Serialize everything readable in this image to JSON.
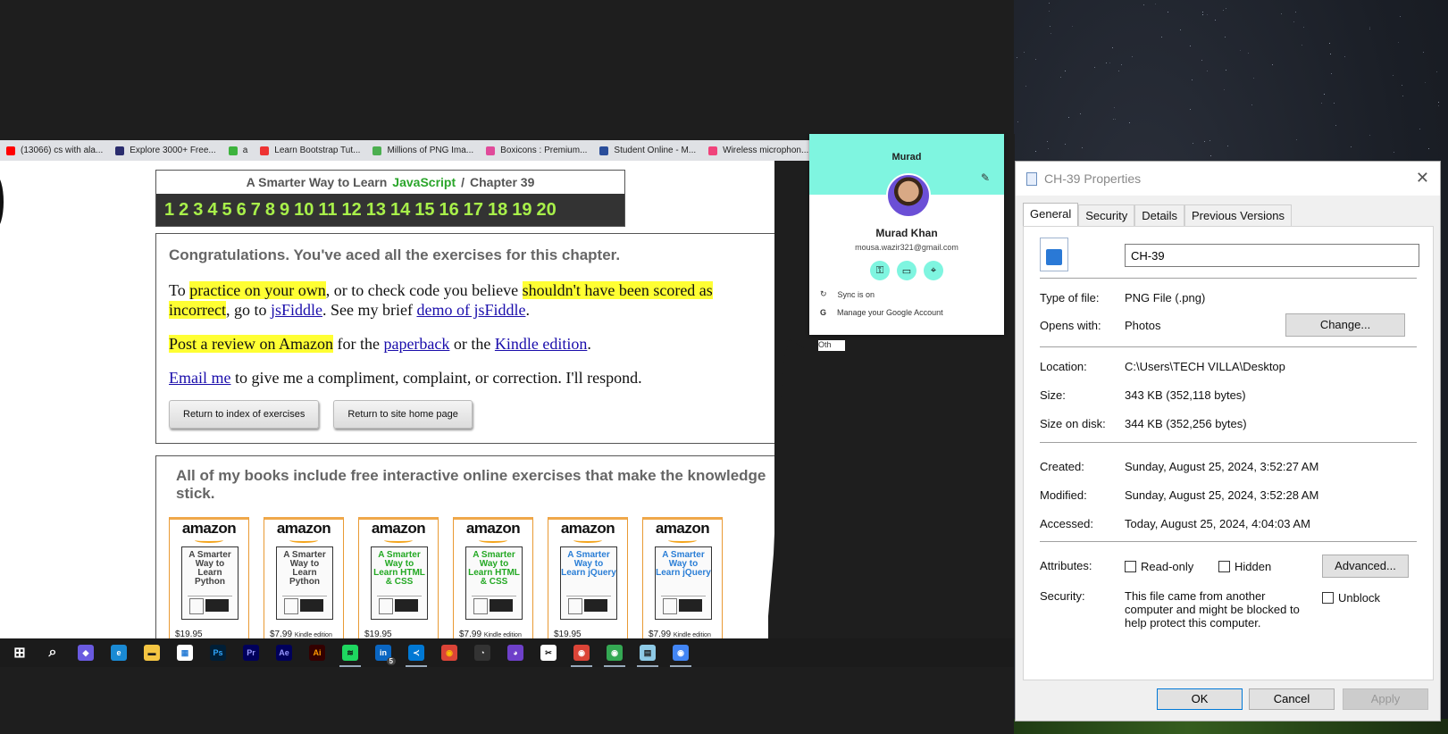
{
  "bookmarks": [
    {
      "label": "(13066) cs with ala...",
      "icon": "youtube-icon",
      "color": "#ff0000"
    },
    {
      "label": "Explore 3000+ Free...",
      "icon": "ui-icon",
      "color": "#2b2d6e"
    },
    {
      "label": "a",
      "icon": "s-icon",
      "color": "#3db33d"
    },
    {
      "label": "Learn Bootstrap Tut...",
      "icon": "v-icon",
      "color": "#e33"
    },
    {
      "label": "Millions of PNG Ima...",
      "icon": "pngtree-icon",
      "color": "#4caf50"
    },
    {
      "label": "Boxicons : Premium...",
      "icon": "boxicons-icon",
      "color": "#e04a9a"
    },
    {
      "label": "Student Online - M...",
      "icon": "student-icon",
      "color": "#2a4d9a"
    },
    {
      "label": "Wireless microphon...",
      "icon": "daraz-icon",
      "color": "#f0437b"
    }
  ],
  "chapter": {
    "prefix": "A Smarter Way to Learn",
    "subject": "JavaScript",
    "separator": "/",
    "label": "Chapter 39",
    "numbers": [
      "1",
      "2",
      "3",
      "4",
      "5",
      "6",
      "7",
      "8",
      "9",
      "10",
      "11",
      "12",
      "13",
      "14",
      "15",
      "16",
      "17",
      "18",
      "19",
      "20"
    ]
  },
  "congrats": {
    "title": "Congratulations. You've aced all the exercises for this chapter.",
    "p1": {
      "a": "To ",
      "hl1": "practice on your own",
      "b": ", or to check code you believe ",
      "hl2": "shouldn't have been scored as incorrect",
      "c": ", go to ",
      "link1": "jsFiddle",
      "d": ". See my brief ",
      "link2": "demo of jsFiddle",
      "e": "."
    },
    "p2": {
      "hl": "Post a review on Amazon",
      "a": " for the ",
      "link1": "paperback",
      "b": " or the ",
      "link2": "Kindle edition",
      "c": "."
    },
    "p3": {
      "link": "Email me",
      "a": " to give me a compliment, complaint, or correction. I'll respond."
    },
    "btn_index": "Return to index of exercises",
    "btn_home": "Return to site home page"
  },
  "books": {
    "title": "All of my books include free interactive online exercises that make the knowledge stick.",
    "brand": "amazon",
    "items": [
      {
        "cover": "A Smarter Way to Learn Python",
        "price": "$19.95",
        "edition": "",
        "color": "#444"
      },
      {
        "cover": "A Smarter Way to Learn Python",
        "price": "$7.99",
        "edition": "Kindle edition",
        "color": "#444"
      },
      {
        "cover": "A Smarter Way to Learn HTML & CSS",
        "price": "$19.95",
        "edition": "",
        "color": "#23a823"
      },
      {
        "cover": "A Smarter Way to Learn HTML & CSS",
        "price": "$7.99",
        "edition": "Kindle edition",
        "color": "#23a823"
      },
      {
        "cover": "A Smarter Way to Learn jQuery",
        "price": "$19.95",
        "edition": "",
        "color": "#2a7ed6"
      },
      {
        "cover": "A Smarter Way to Learn jQuery",
        "price": "$7.99",
        "edition": "Kindle edition",
        "color": "#2a7ed6"
      }
    ]
  },
  "profile": {
    "header_name": "Murad",
    "name": "Murad Khan",
    "email": "mousa.wazir321@gmail.com",
    "sync": "Sync is on",
    "manage": "Manage your Google Account",
    "other": "Oth",
    "accent": "#7ff5e0"
  },
  "taskbar": [
    {
      "name": "start-button",
      "icon": "windows-icon",
      "text": "⊞",
      "color": "#ffffff",
      "bg": "transparent"
    },
    {
      "name": "search-button",
      "icon": "search-icon",
      "text": "⌕",
      "color": "#ffffff",
      "bg": "transparent"
    },
    {
      "name": "copilot-button",
      "icon": "copilot-icon",
      "text": "◆",
      "color": "#ffffff",
      "bg": "#6a5ae0"
    },
    {
      "name": "edge-button",
      "icon": "edge-icon",
      "text": "e",
      "color": "#ffffff",
      "bg": "#1a8ad4"
    },
    {
      "name": "explorer-button",
      "icon": "folder-icon",
      "text": "▬",
      "color": "#1b1b1b",
      "bg": "#f4c542"
    },
    {
      "name": "store-button",
      "icon": "store-icon",
      "text": "▦",
      "color": "#2a7ed6",
      "bg": "#ffffff"
    },
    {
      "name": "photoshop-button",
      "icon": "photoshop-icon",
      "text": "Ps",
      "color": "#31a8ff",
      "bg": "#001e36"
    },
    {
      "name": "premiere-button",
      "icon": "premiere-icon",
      "text": "Pr",
      "color": "#9999ff",
      "bg": "#00005b"
    },
    {
      "name": "aftereffects-button",
      "icon": "aftereffects-icon",
      "text": "Ae",
      "color": "#9999ff",
      "bg": "#00005b"
    },
    {
      "name": "illustrator-button",
      "icon": "illustrator-icon",
      "text": "Ai",
      "color": "#ff9a00",
      "bg": "#330000"
    },
    {
      "name": "spotify-button",
      "icon": "spotify-icon",
      "text": "≋",
      "color": "#111111",
      "bg": "#1ed760"
    },
    {
      "name": "linkedin-button",
      "icon": "linkedin-icon",
      "text": "in",
      "color": "#ffffff",
      "bg": "#0a66c2"
    },
    {
      "name": "vscode-button",
      "icon": "vscode-icon",
      "text": "≺",
      "color": "#ffffff",
      "bg": "#0078d4"
    },
    {
      "name": "chrome-button",
      "icon": "chrome-icon",
      "text": "◉",
      "color": "#fbbc05",
      "bg": "#db4437"
    },
    {
      "name": "obs-button",
      "icon": "obs-icon",
      "text": "◔",
      "color": "#ffffff",
      "bg": "#333333"
    },
    {
      "name": "github-button",
      "icon": "github-icon",
      "text": "◕",
      "color": "#ffffff",
      "bg": "#6e40c9"
    },
    {
      "name": "capcut-button",
      "icon": "capcut-icon",
      "text": "✂",
      "color": "#111111",
      "bg": "#ffffff"
    },
    {
      "name": "chrome-profile1-button",
      "icon": "chrome-icon",
      "text": "◉",
      "color": "#ffffff",
      "bg": "#db4437"
    },
    {
      "name": "chrome-profile2-button",
      "icon": "chrome-icon",
      "text": "◉",
      "color": "#ffffff",
      "bg": "#34a853"
    },
    {
      "name": "notepad-button",
      "icon": "notepad-icon",
      "text": "▤",
      "color": "#1b1b1b",
      "bg": "#8ecae6"
    },
    {
      "name": "chrome-profile3-button",
      "icon": "chrome-icon",
      "text": "◉",
      "color": "#ffffff",
      "bg": "#4285f4"
    }
  ],
  "taskbar_badge": "5",
  "props": {
    "title": "CH-39 Properties",
    "tabs": [
      "General",
      "Security",
      "Details",
      "Previous Versions"
    ],
    "filename": "CH-39",
    "type_label": "Type of file:",
    "type_value": "PNG File (.png)",
    "opens_label": "Opens with:",
    "opens_value": "Photos",
    "change_btn": "Change...",
    "location_label": "Location:",
    "location_value": "C:\\Users\\TECH VILLA\\Desktop",
    "size_label": "Size:",
    "size_value": "343 KB (352,118 bytes)",
    "sod_label": "Size on disk:",
    "sod_value": "344 KB (352,256 bytes)",
    "created_label": "Created:",
    "created_value": "Sunday, August 25, 2024, 3:52:27 AM",
    "modified_label": "Modified:",
    "modified_value": "Sunday, August 25, 2024, 3:52:28 AM",
    "accessed_label": "Accessed:",
    "accessed_value": "Today, August 25, 2024, 4:04:03 AM",
    "attributes_label": "Attributes:",
    "readonly": "Read-only",
    "hidden": "Hidden",
    "advanced_btn": "Advanced...",
    "security_label": "Security:",
    "security_text": "This file came from another computer and might be blocked to help protect this computer.",
    "unblock": "Unblock",
    "ok": "OK",
    "cancel": "Cancel",
    "apply": "Apply"
  }
}
